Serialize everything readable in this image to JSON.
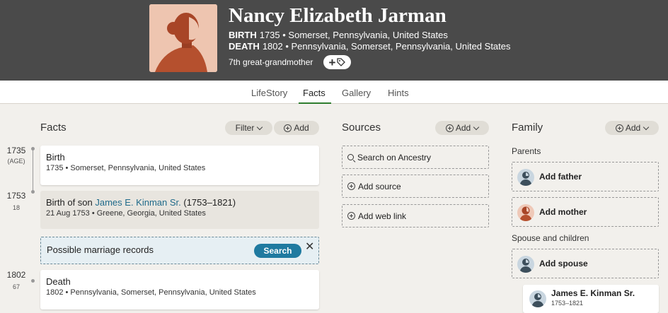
{
  "person": {
    "name": "Nancy Elizabeth Jarman",
    "birth_label": "BIRTH",
    "birth_text": "1735 • Somerset, Pennsylvania, United States",
    "death_label": "DEATH",
    "death_text": "1802 • Pennsylvania, Somerset, Pennsylvania, United States",
    "relationship": "7th great-grandmother"
  },
  "tabs": [
    {
      "label": "LifeStory",
      "active": false
    },
    {
      "label": "Facts",
      "active": true
    },
    {
      "label": "Gallery",
      "active": false
    },
    {
      "label": "Hints",
      "active": false
    }
  ],
  "facts": {
    "title": "Facts",
    "filter_label": "Filter",
    "add_label": "Add",
    "timeline": [
      {
        "year": "1735",
        "age": "(AGE)"
      },
      {
        "year": "1753",
        "age": "18"
      },
      {
        "year": "1802",
        "age": "67"
      }
    ],
    "cards": [
      {
        "title": "Birth",
        "detail": "1735 • Somerset, Pennsylvania, United States"
      },
      {
        "title_prefix": "Birth of son ",
        "title_link": "James E. Kinman Sr.",
        "title_suffix": " (1753–1821)",
        "detail": "21 Aug 1753 • Greene, Georgia, United States"
      },
      {
        "title": "Death",
        "detail": "1802 • Pennsylvania, Somerset, Pennsylvania, United States"
      }
    ],
    "marriage": {
      "text": "Possible marriage records",
      "search_label": "Search",
      "close": "✕"
    }
  },
  "sources": {
    "title": "Sources",
    "add_label": "Add",
    "items": [
      "Search on Ancestry",
      "Add source",
      "Add web link"
    ]
  },
  "family": {
    "title": "Family",
    "add_label": "Add",
    "parents_label": "Parents",
    "add_father": "Add father",
    "add_mother": "Add mother",
    "spouse_label": "Spouse and children",
    "add_spouse": "Add spouse",
    "child": {
      "name": "James E. Kinman Sr.",
      "dates": "1753–1821"
    }
  },
  "colors": {
    "header_bg": "#4a4a4a",
    "active_tab": "#2e7d2e",
    "link": "#1f6a8a",
    "search_button": "#1f7aa0"
  }
}
